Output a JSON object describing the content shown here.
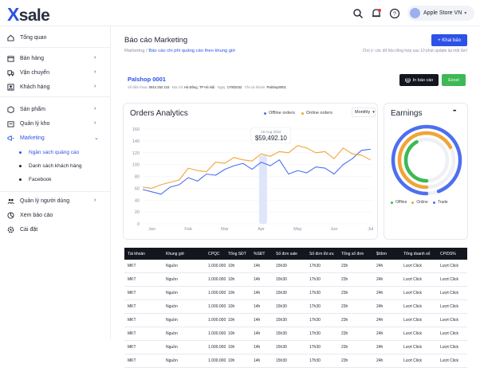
{
  "topbar": {
    "logo_x": "X",
    "logo_rest": "sale",
    "user_name": "Apple Store VN"
  },
  "sidebar": {
    "items": [
      {
        "label": "Tổng quan",
        "icon": "home-icon"
      },
      {
        "label": "Bán hàng",
        "icon": "cart-icon"
      },
      {
        "label": "Vận chuyển",
        "icon": "truck-icon"
      },
      {
        "label": "Khách hàng",
        "icon": "user-icon"
      },
      {
        "label": "Sản phẩm",
        "icon": "box-icon"
      },
      {
        "label": "Quản lý kho",
        "icon": "warehouse-icon"
      },
      {
        "label": "Marketing",
        "icon": "megaphone-icon"
      },
      {
        "label": "Quản lý người dùng",
        "icon": "users-icon"
      },
      {
        "label": "Xem báo cáo",
        "icon": "report-icon"
      },
      {
        "label": "Cài đặt",
        "icon": "settings-icon"
      }
    ],
    "marketing_sub": [
      "Ngân sách quảng cáo",
      "Danh sách khách hàng",
      "Facebook"
    ]
  },
  "page": {
    "title": "Báo cáo Marketing",
    "breadcrumb_root": "Marketing",
    "breadcrumb_sep": "/",
    "breadcrumb_current": "Báo cáo chi phí quảng cáo theo khung giờ",
    "add_button": "+ Khai báo",
    "note": "Chú ý: các dữ liệu tổng hợp sau 10 phút update lại một lần!"
  },
  "shop": {
    "name": "Palshop 0001",
    "meta": [
      {
        "k": "Số điện thoại:",
        "v": "0914 252 215"
      },
      {
        "k": "Địa chỉ:",
        "v": "Hà Đông, TP Hà Nội"
      },
      {
        "k": "Ngày:",
        "v": "17/8/2022"
      },
      {
        "k": "Tên tài khoản:",
        "v": "Palshop0001"
      }
    ],
    "print_button": "In báo cáo",
    "excel_button": "Excel"
  },
  "orders": {
    "title": "Orders Analytics",
    "legend_offline": "Offline orders",
    "legend_online": "Online orders",
    "period": "Monthly",
    "tooltip_date": "15 Aug 2022",
    "tooltip_value": "$59,492.10"
  },
  "earnings": {
    "title": "Earnings",
    "more": "•••",
    "legend": [
      "Offline",
      "Online",
      "Trade"
    ]
  },
  "colors": {
    "accent": "#2c52e8",
    "offline": "#4d6ff0",
    "online": "#f0a535",
    "trade": "#4d6ff0",
    "green": "#3cb955",
    "dark": "#14161f"
  },
  "chart_data": {
    "type": "line",
    "categories": [
      "Jan",
      "Feb",
      "Mar",
      "Apr",
      "May",
      "Jun",
      "Jul"
    ],
    "ylim": [
      0,
      160
    ],
    "yticks": [
      "0",
      "20",
      "40",
      "60",
      "80",
      "100",
      "120",
      "140",
      "160"
    ],
    "x": [
      0,
      0.25,
      0.5,
      0.75,
      1,
      1.25,
      1.5,
      1.75,
      2,
      2.25,
      2.5,
      2.75,
      3,
      3.25,
      3.5,
      3.75,
      4,
      4.25,
      4.5,
      4.75,
      5,
      5.25,
      5.5,
      5.75,
      6,
      6.25
    ],
    "series": [
      {
        "name": "Offline orders",
        "values": [
          58,
          54,
          50,
          62,
          66,
          78,
          72,
          84,
          82,
          92,
          98,
          102,
          92,
          104,
          98,
          108,
          84,
          90,
          86,
          96,
          94,
          84,
          100,
          110,
          124,
          126
        ]
      },
      {
        "name": "Online orders",
        "values": [
          62,
          60,
          66,
          70,
          74,
          94,
          90,
          88,
          104,
          102,
          112,
          108,
          106,
          118,
          114,
          122,
          120,
          132,
          128,
          120,
          122,
          110,
          128,
          118,
          116,
          108
        ]
      }
    ],
    "highlight_x": 3.3
  },
  "donut": {
    "series": [
      {
        "name": "Offline",
        "value": 0.42
      },
      {
        "name": "Online",
        "value": 0.67
      },
      {
        "name": "Trade",
        "value": 0.94
      }
    ]
  },
  "table": {
    "headers": [
      "Tài khoản",
      "Khung giờ",
      "CPQC",
      "Tổng SĐT",
      "%SĐT",
      "Số đơn sale",
      "Số đơn tồi ưu",
      "Tổng số đơn",
      "$/đơn",
      "Tổng doanh số",
      "CP/DS%"
    ],
    "rows": [
      [
        "MKT",
        "Nguồn",
        "1.000.000",
        "10h",
        "14h",
        "15h30",
        "17h30",
        "23h",
        "24h",
        "Lượt Click",
        "Lượt Click"
      ],
      [
        "MKT",
        "Nguồn",
        "1.000.000",
        "10h",
        "14h",
        "15h30",
        "17h30",
        "23h",
        "24h",
        "Lượt Click",
        "Lượt Click"
      ],
      [
        "MKT",
        "Nguồn",
        "1.000.000",
        "10h",
        "14h",
        "15h30",
        "17h30",
        "23h",
        "24h",
        "Lượt Click",
        "Lượt Click"
      ],
      [
        "MKT",
        "Nguồn",
        "1.000.000",
        "10h",
        "14h",
        "15h30",
        "17h30",
        "23h",
        "24h",
        "Lượt Click",
        "Lượt Click"
      ],
      [
        "MKT",
        "Nguồn",
        "1.000.000",
        "10h",
        "14h",
        "15h30",
        "17h30",
        "23h",
        "24h",
        "Lượt Click",
        "Lượt Click"
      ],
      [
        "MKT",
        "Nguồn",
        "1.000.000",
        "10h",
        "14h",
        "15h30",
        "17h30",
        "23h",
        "24h",
        "Lượt Click",
        "Lượt Click"
      ],
      [
        "MKT",
        "Nguồn",
        "1.000.000",
        "10h",
        "14h",
        "15h30",
        "17h30",
        "23h",
        "24h",
        "Lượt Click",
        "Lượt Click"
      ],
      [
        "MKT",
        "Nguồn",
        "1.000.000",
        "10h",
        "14h",
        "15h30",
        "17h30",
        "23h",
        "24h",
        "Lượt Click",
        "Lượt Click"
      ]
    ]
  }
}
